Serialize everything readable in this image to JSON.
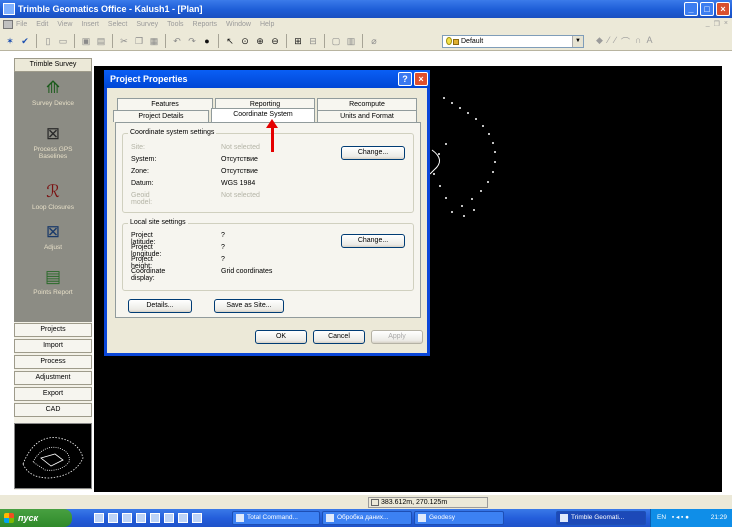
{
  "window": {
    "title": "Trimble Geomatics Office - Kalush1 - [Plan]"
  },
  "menu": {
    "items": [
      "File",
      "Edit",
      "View",
      "Insert",
      "Select",
      "Survey",
      "Tools",
      "Reports",
      "Window",
      "Help"
    ]
  },
  "toolbar": {
    "layer_value": "Default"
  },
  "left_panel": {
    "header": "Trimble Survey",
    "icon_items": [
      {
        "label": "Survey Device",
        "icon": "gps-antenna-icon"
      },
      {
        "label": "Process GPS Baselines",
        "icon": "baseline-network-icon"
      },
      {
        "label": "Loop Closures",
        "icon": "loop-closure-icon"
      },
      {
        "label": "Adjust",
        "icon": "adjust-network-icon"
      },
      {
        "label": "Points Report",
        "icon": "points-report-icon"
      }
    ],
    "categories": [
      "Projects",
      "Import",
      "Process",
      "Adjustment",
      "Export",
      "CAD"
    ]
  },
  "dialog": {
    "title": "Project Properties",
    "tabs_back": [
      "Features",
      "Reporting",
      "Recompute"
    ],
    "tabs_front": [
      "Project Details",
      "Coordinate System",
      "Units and Format"
    ],
    "active_tab": "Coordinate System",
    "coord_group": {
      "title": "Coordinate system settings",
      "rows": [
        {
          "label": "Site:",
          "value": "Not selected",
          "disabled": true
        },
        {
          "label": "System:",
          "value": "Отсутствие",
          "disabled": false
        },
        {
          "label": "Zone:",
          "value": "Отсутствие",
          "disabled": false
        },
        {
          "label": "Datum:",
          "value": "WGS 1984",
          "disabled": false
        },
        {
          "label": "Geoid model:",
          "value": "Not selected",
          "disabled": true
        }
      ],
      "change_label": "Change..."
    },
    "local_group": {
      "title": "Local site settings",
      "rows": [
        {
          "label": "Project latitude:",
          "value": "?"
        },
        {
          "label": "Project longitude:",
          "value": "?"
        },
        {
          "label": "Project height:",
          "value": "?"
        },
        {
          "label": "Coordinate display:",
          "value": "Grid coordinates"
        }
      ],
      "change_label": "Change..."
    },
    "details_label": "Details...",
    "save_site_label": "Save as Site...",
    "ok_label": "OK",
    "cancel_label": "Cancel",
    "apply_label": "Apply"
  },
  "status": {
    "coordinates": "383.612m, 270.125m"
  },
  "taskbar": {
    "start_label": "пуск",
    "tasks": [
      "Total Command...",
      "Обробка даних...",
      "Geodesy",
      "Trimble Geomati..."
    ],
    "tray_lang": "EN",
    "clock": "21:29"
  },
  "colors": {
    "title_blue": "#0a5ff5",
    "annotation_red": "#e50000",
    "canvas": "#000000"
  }
}
